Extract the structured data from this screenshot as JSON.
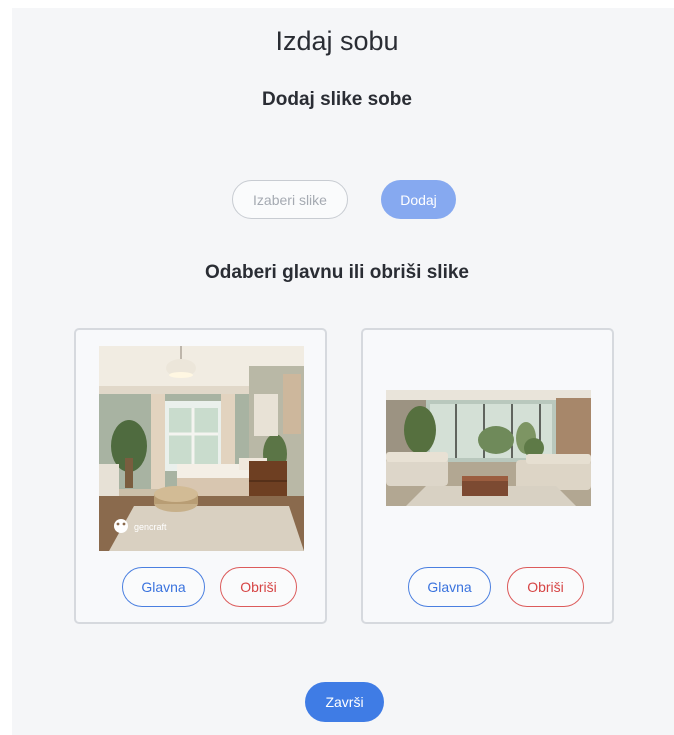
{
  "page": {
    "title": "Izdaj sobu",
    "subtitle": "Dodaj slike sobe",
    "section_title": "Odaberi glavnu ili obriši slike"
  },
  "upload": {
    "choose_label": "Izaberi slike",
    "add_label": "Dodaj"
  },
  "images": [
    {
      "watermark": "gencraft",
      "main_label": "Glavna",
      "delete_label": "Obriši"
    },
    {
      "main_label": "Glavna",
      "delete_label": "Obriši"
    }
  ],
  "footer": {
    "finish_label": "Završi"
  },
  "colors": {
    "primary": "#3f7ce5",
    "primary_light": "#86a9f0",
    "danger": "#d64545",
    "panel_bg": "#f5f6f8"
  }
}
